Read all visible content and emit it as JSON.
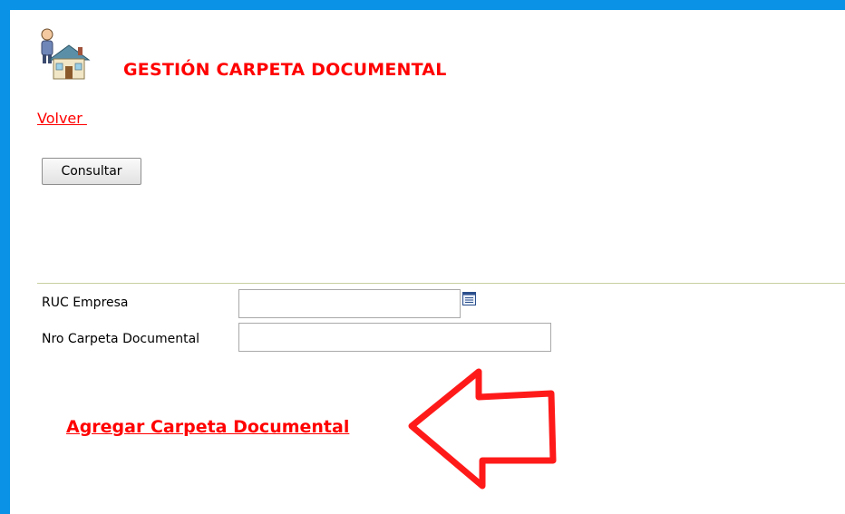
{
  "header": {
    "title": "GESTIÓN CARPETA DOCUMENTAL",
    "icon": "user-house-icon"
  },
  "nav": {
    "back_label": "Volver "
  },
  "toolbar": {
    "consult_label": "Consultar"
  },
  "form": {
    "ruc_label": "RUC Empresa",
    "ruc_value": "",
    "nro_label": "Nro Carpeta Documental",
    "nro_value": "",
    "lookup_icon": "list-lookup-icon"
  },
  "actions": {
    "add_label": "Agregar Carpeta Documental"
  },
  "annotation": {
    "icon": "arrow-left-icon",
    "color": "#ff1a1a"
  },
  "colors": {
    "frame": "#0a93e6",
    "accent_red": "#ff0000",
    "divider": "#c9cf9f"
  }
}
